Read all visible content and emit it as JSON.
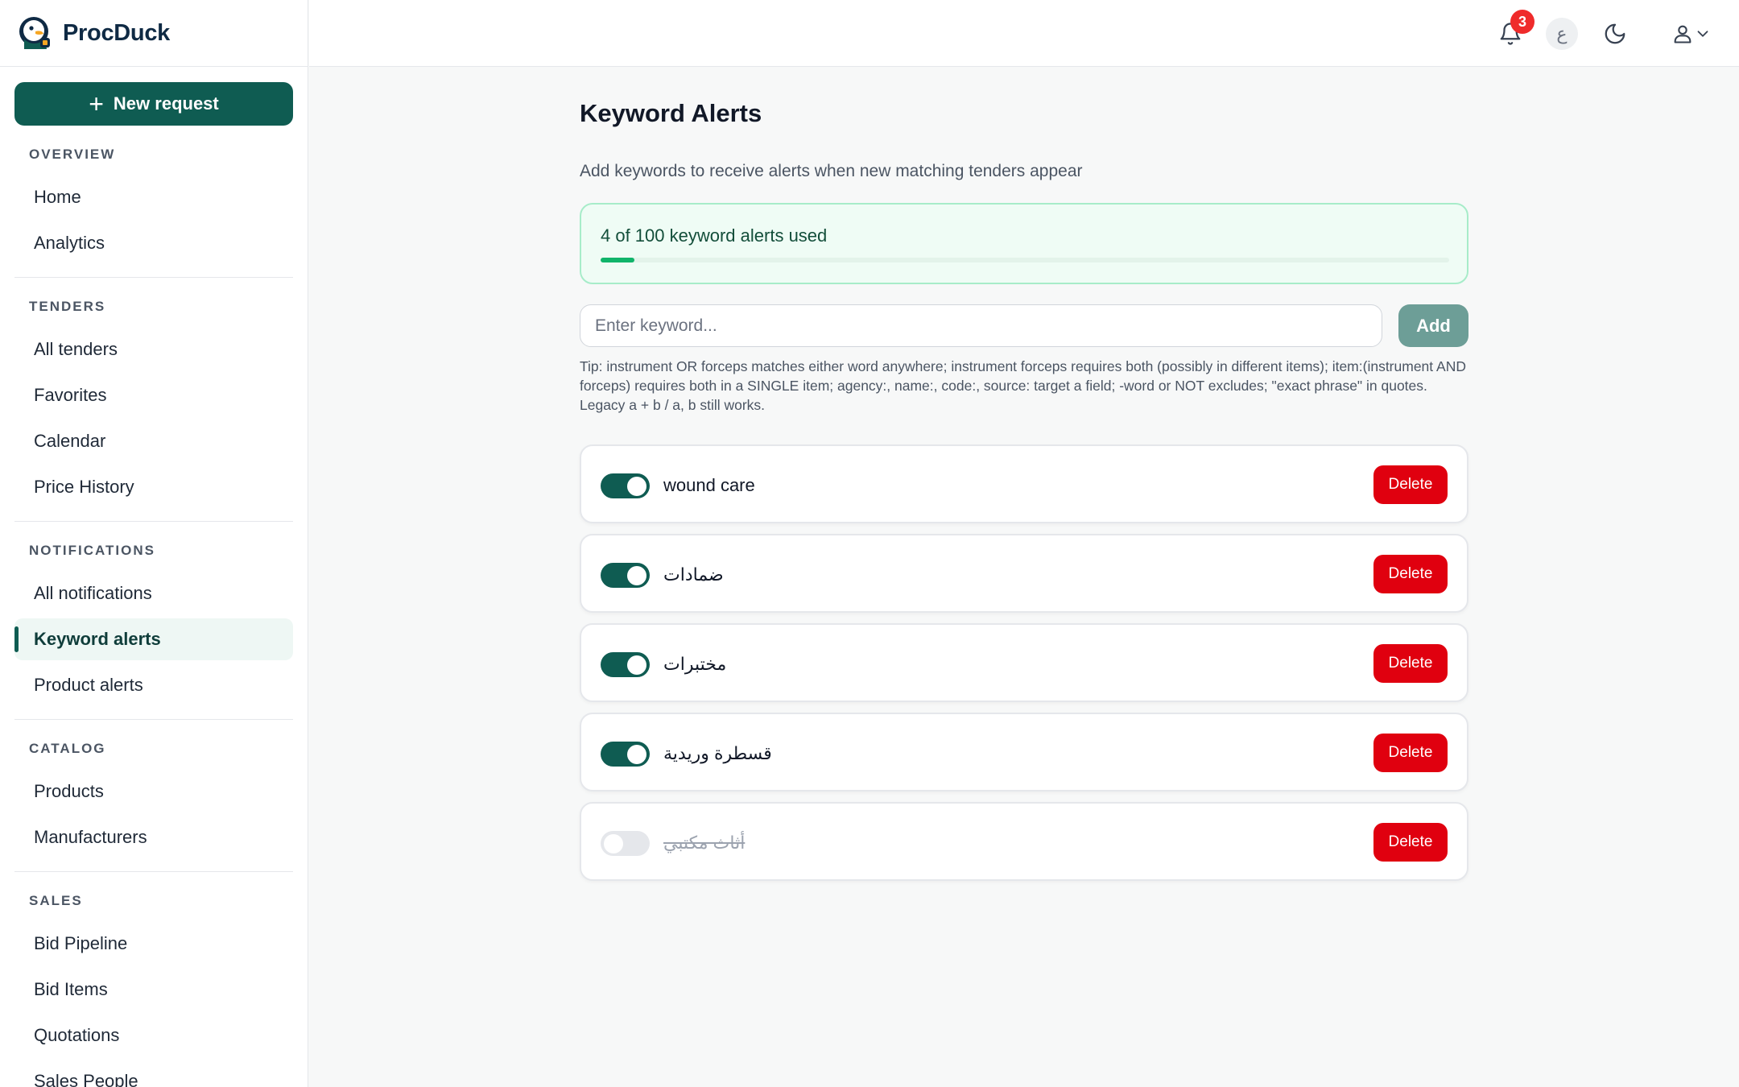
{
  "brand": {
    "name": "ProcDuck"
  },
  "sidebar": {
    "new_request_label": "New request",
    "sections": [
      {
        "title": "OVERVIEW",
        "items": [
          "Home",
          "Analytics"
        ]
      },
      {
        "title": "TENDERS",
        "items": [
          "All tenders",
          "Favorites",
          "Calendar",
          "Price History"
        ]
      },
      {
        "title": "NOTIFICATIONS",
        "items": [
          "All notifications",
          "Keyword alerts",
          "Product alerts"
        ]
      },
      {
        "title": "CATALOG",
        "items": [
          "Products",
          "Manufacturers"
        ]
      },
      {
        "title": "SALES",
        "items": [
          "Bid Pipeline",
          "Bid Items",
          "Quotations",
          "Sales People"
        ]
      }
    ],
    "active_item": "Keyword alerts"
  },
  "header": {
    "notification_count": "3",
    "language_label": "ع",
    "icons": [
      "bell-icon",
      "moon-icon",
      "user-icon",
      "chevron-down-icon"
    ]
  },
  "main": {
    "title": "Keyword Alerts",
    "subtitle": "Add keywords to receive alerts when new matching tenders appear",
    "usage": {
      "text": "4 of 100 keyword alerts used",
      "used": 4,
      "limit": 100
    },
    "input": {
      "placeholder": "Enter keyword...",
      "value": ""
    },
    "add_label": "Add",
    "tip": "Tip: instrument OR forceps matches either word anywhere; instrument forceps requires both (possibly in different items); item:(instrument AND forceps) requires both in a SINGLE item; agency:, name:, code:, source: target a field; -word or NOT excludes; \"exact phrase\" in quotes. Legacy a + b / a, b still works.",
    "alerts": [
      {
        "keyword": "wound care",
        "enabled": true,
        "delete_label": "Delete"
      },
      {
        "keyword": "ضمادات",
        "enabled": true,
        "delete_label": "Delete"
      },
      {
        "keyword": "مختبرات",
        "enabled": true,
        "delete_label": "Delete"
      },
      {
        "keyword": "قسطرة وريدية",
        "enabled": true,
        "delete_label": "Delete"
      },
      {
        "keyword": "أثاث مكتبي",
        "enabled": false,
        "delete_label": "Delete"
      }
    ]
  },
  "colors": {
    "primary": "#0f5c52",
    "delete": "#e0000f",
    "badge": "#ef2b2b",
    "usage_bg": "#effcf5",
    "usage_fill": "#10b46a"
  }
}
